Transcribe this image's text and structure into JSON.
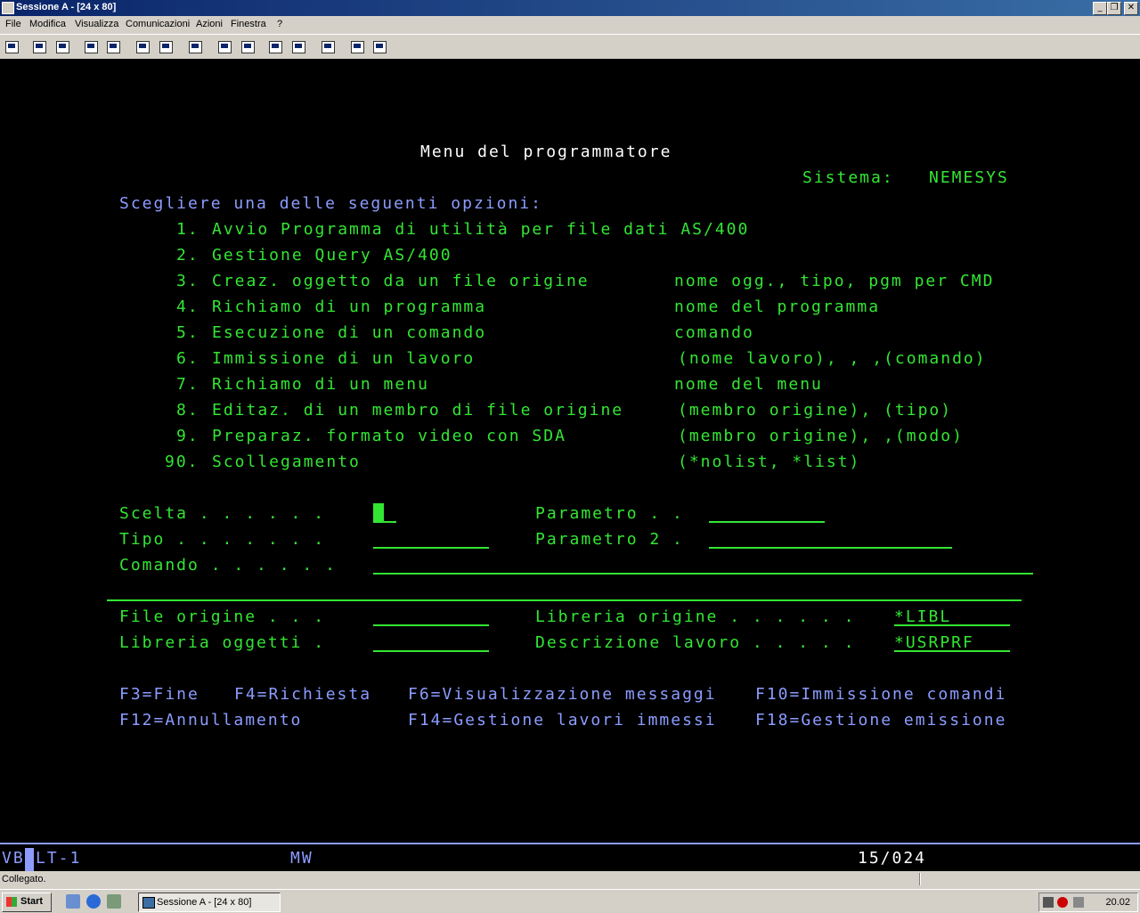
{
  "window": {
    "title": "Sessione A - [24 x 80]"
  },
  "menu": [
    "File",
    "Modifica",
    "Visualizza",
    "Comunicazioni",
    "Azioni",
    "Finestra",
    "?"
  ],
  "screen": {
    "title": "Menu del programmatore",
    "system_label": "Sistema:",
    "system_value": "NEMESYS",
    "prompt": "Scegliere una delle seguenti opzioni:",
    "options": [
      {
        "num": "1.",
        "label": "Avvio Programma di utilità per file dati AS/400",
        "hint": ""
      },
      {
        "num": "2.",
        "label": "Gestione Query AS/400",
        "hint": ""
      },
      {
        "num": "3.",
        "label": "Creaz. oggetto da un file origine",
        "hint": "nome ogg., tipo, pgm per CMD"
      },
      {
        "num": "4.",
        "label": "Richiamo di un programma",
        "hint": "nome del programma"
      },
      {
        "num": "5.",
        "label": "Esecuzione di un comando",
        "hint": "comando"
      },
      {
        "num": "6.",
        "label": "Immissione di un lavoro",
        "hint": "(nome lavoro), , ,(comando)"
      },
      {
        "num": "7.",
        "label": "Richiamo di un menu",
        "hint": "nome del menu"
      },
      {
        "num": "8.",
        "label": "Editaz. di un membro di file origine",
        "hint": "(membro origine), (tipo)"
      },
      {
        "num": "9.",
        "label": "Preparaz. formato video con SDA",
        "hint": "(membro origine), ,(modo)"
      },
      {
        "num": "90.",
        "label": "Scollegamento",
        "hint": "(*nolist, *list)"
      }
    ],
    "fields": {
      "scelta": "Scelta . . . . . .",
      "tipo": "Tipo . . . . . . .",
      "comando": "Comando . . . . . .",
      "parametro": "Parametro . .",
      "parametro2": "Parametro 2 .",
      "file_origine": "File origine . . .",
      "libreria_oggetti": "Libreria oggetti .",
      "libreria_origine": "Libreria origine . . . . . .",
      "libreria_origine_value": "*LIBL",
      "descrizione_lavoro": "Descrizione lavoro . . . . .",
      "descrizione_lavoro_value": "*USRPRF"
    },
    "fkeys_row1": [
      "F3=Fine",
      "F4=Richiesta",
      "F6=Visualizzazione messaggi",
      "F10=Immissione comandi"
    ],
    "fkeys_row2": [
      "F12=Annullamento",
      "F14=Gestione lavori immessi",
      "F18=Gestione emissione"
    ]
  },
  "oia": {
    "left": "VB",
    "session": "LT-1",
    "mode": "MW",
    "position": "15/024"
  },
  "statusbar": {
    "text": "Collegato."
  },
  "taskbar": {
    "start": "Start",
    "task": "Sessione A - [24 x 80]",
    "clock": "20.02"
  }
}
